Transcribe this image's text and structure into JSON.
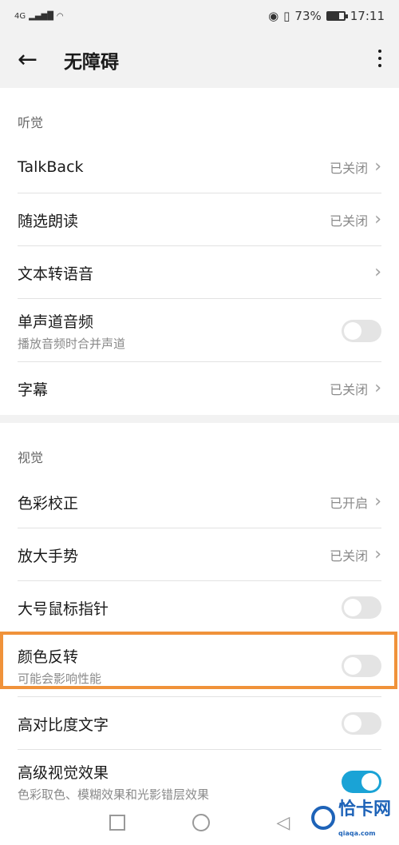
{
  "status": {
    "signal": "4G",
    "battery_percent": "73%",
    "time": "17:11"
  },
  "header": {
    "title": "无障碍"
  },
  "sections": [
    {
      "label": "听觉",
      "items": [
        {
          "title": "TalkBack",
          "value": "已关闭"
        },
        {
          "title": "随选朗读",
          "value": "已关闭"
        },
        {
          "title": "文本转语音",
          "value": ""
        },
        {
          "title": "单声道音频",
          "subtitle": "播放音频时合并声道",
          "toggle": false
        },
        {
          "title": "字幕",
          "value": "已关闭"
        }
      ]
    },
    {
      "label": "视觉",
      "items": [
        {
          "title": "色彩校正",
          "value": "已开启"
        },
        {
          "title": "放大手势",
          "value": "已关闭"
        },
        {
          "title": "大号鼠标指针",
          "toggle": false
        },
        {
          "title": "颜色反转",
          "subtitle": "可能会影响性能",
          "toggle": false
        },
        {
          "title": "高对比度文字",
          "toggle": false
        },
        {
          "title": "高级视觉效果",
          "subtitle": "色彩取色、模糊效果和光影错层效果",
          "toggle": true
        }
      ]
    }
  ],
  "watermark": {
    "text": "恰卡网",
    "small": "qiaqa.com"
  },
  "colors": {
    "highlight": "#f0923a",
    "toggle_on": "#1aa3d6"
  }
}
